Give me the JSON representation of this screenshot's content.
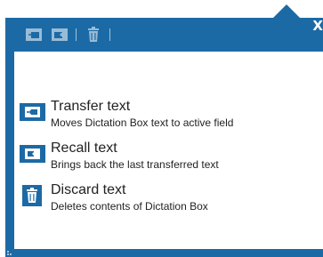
{
  "toolbar": {
    "buttons": [
      {
        "icon": "transfer-text-icon"
      },
      {
        "icon": "recall-text-icon"
      },
      {
        "icon": "trash-icon"
      }
    ],
    "close_label": "X"
  },
  "menu": {
    "items": [
      {
        "icon": "transfer-text-icon",
        "title": "Transfer text",
        "description": "Moves Dictation Box text to active field"
      },
      {
        "icon": "recall-text-icon",
        "title": "Recall text",
        "description": "Brings back the last transferred text"
      },
      {
        "icon": "trash-icon",
        "title": "Discard text",
        "description": "Deletes contents of Dictation Box"
      }
    ]
  },
  "colors": {
    "accent": "#1c6aa5",
    "text": "#222222",
    "icon_fg": "#ffffff"
  }
}
